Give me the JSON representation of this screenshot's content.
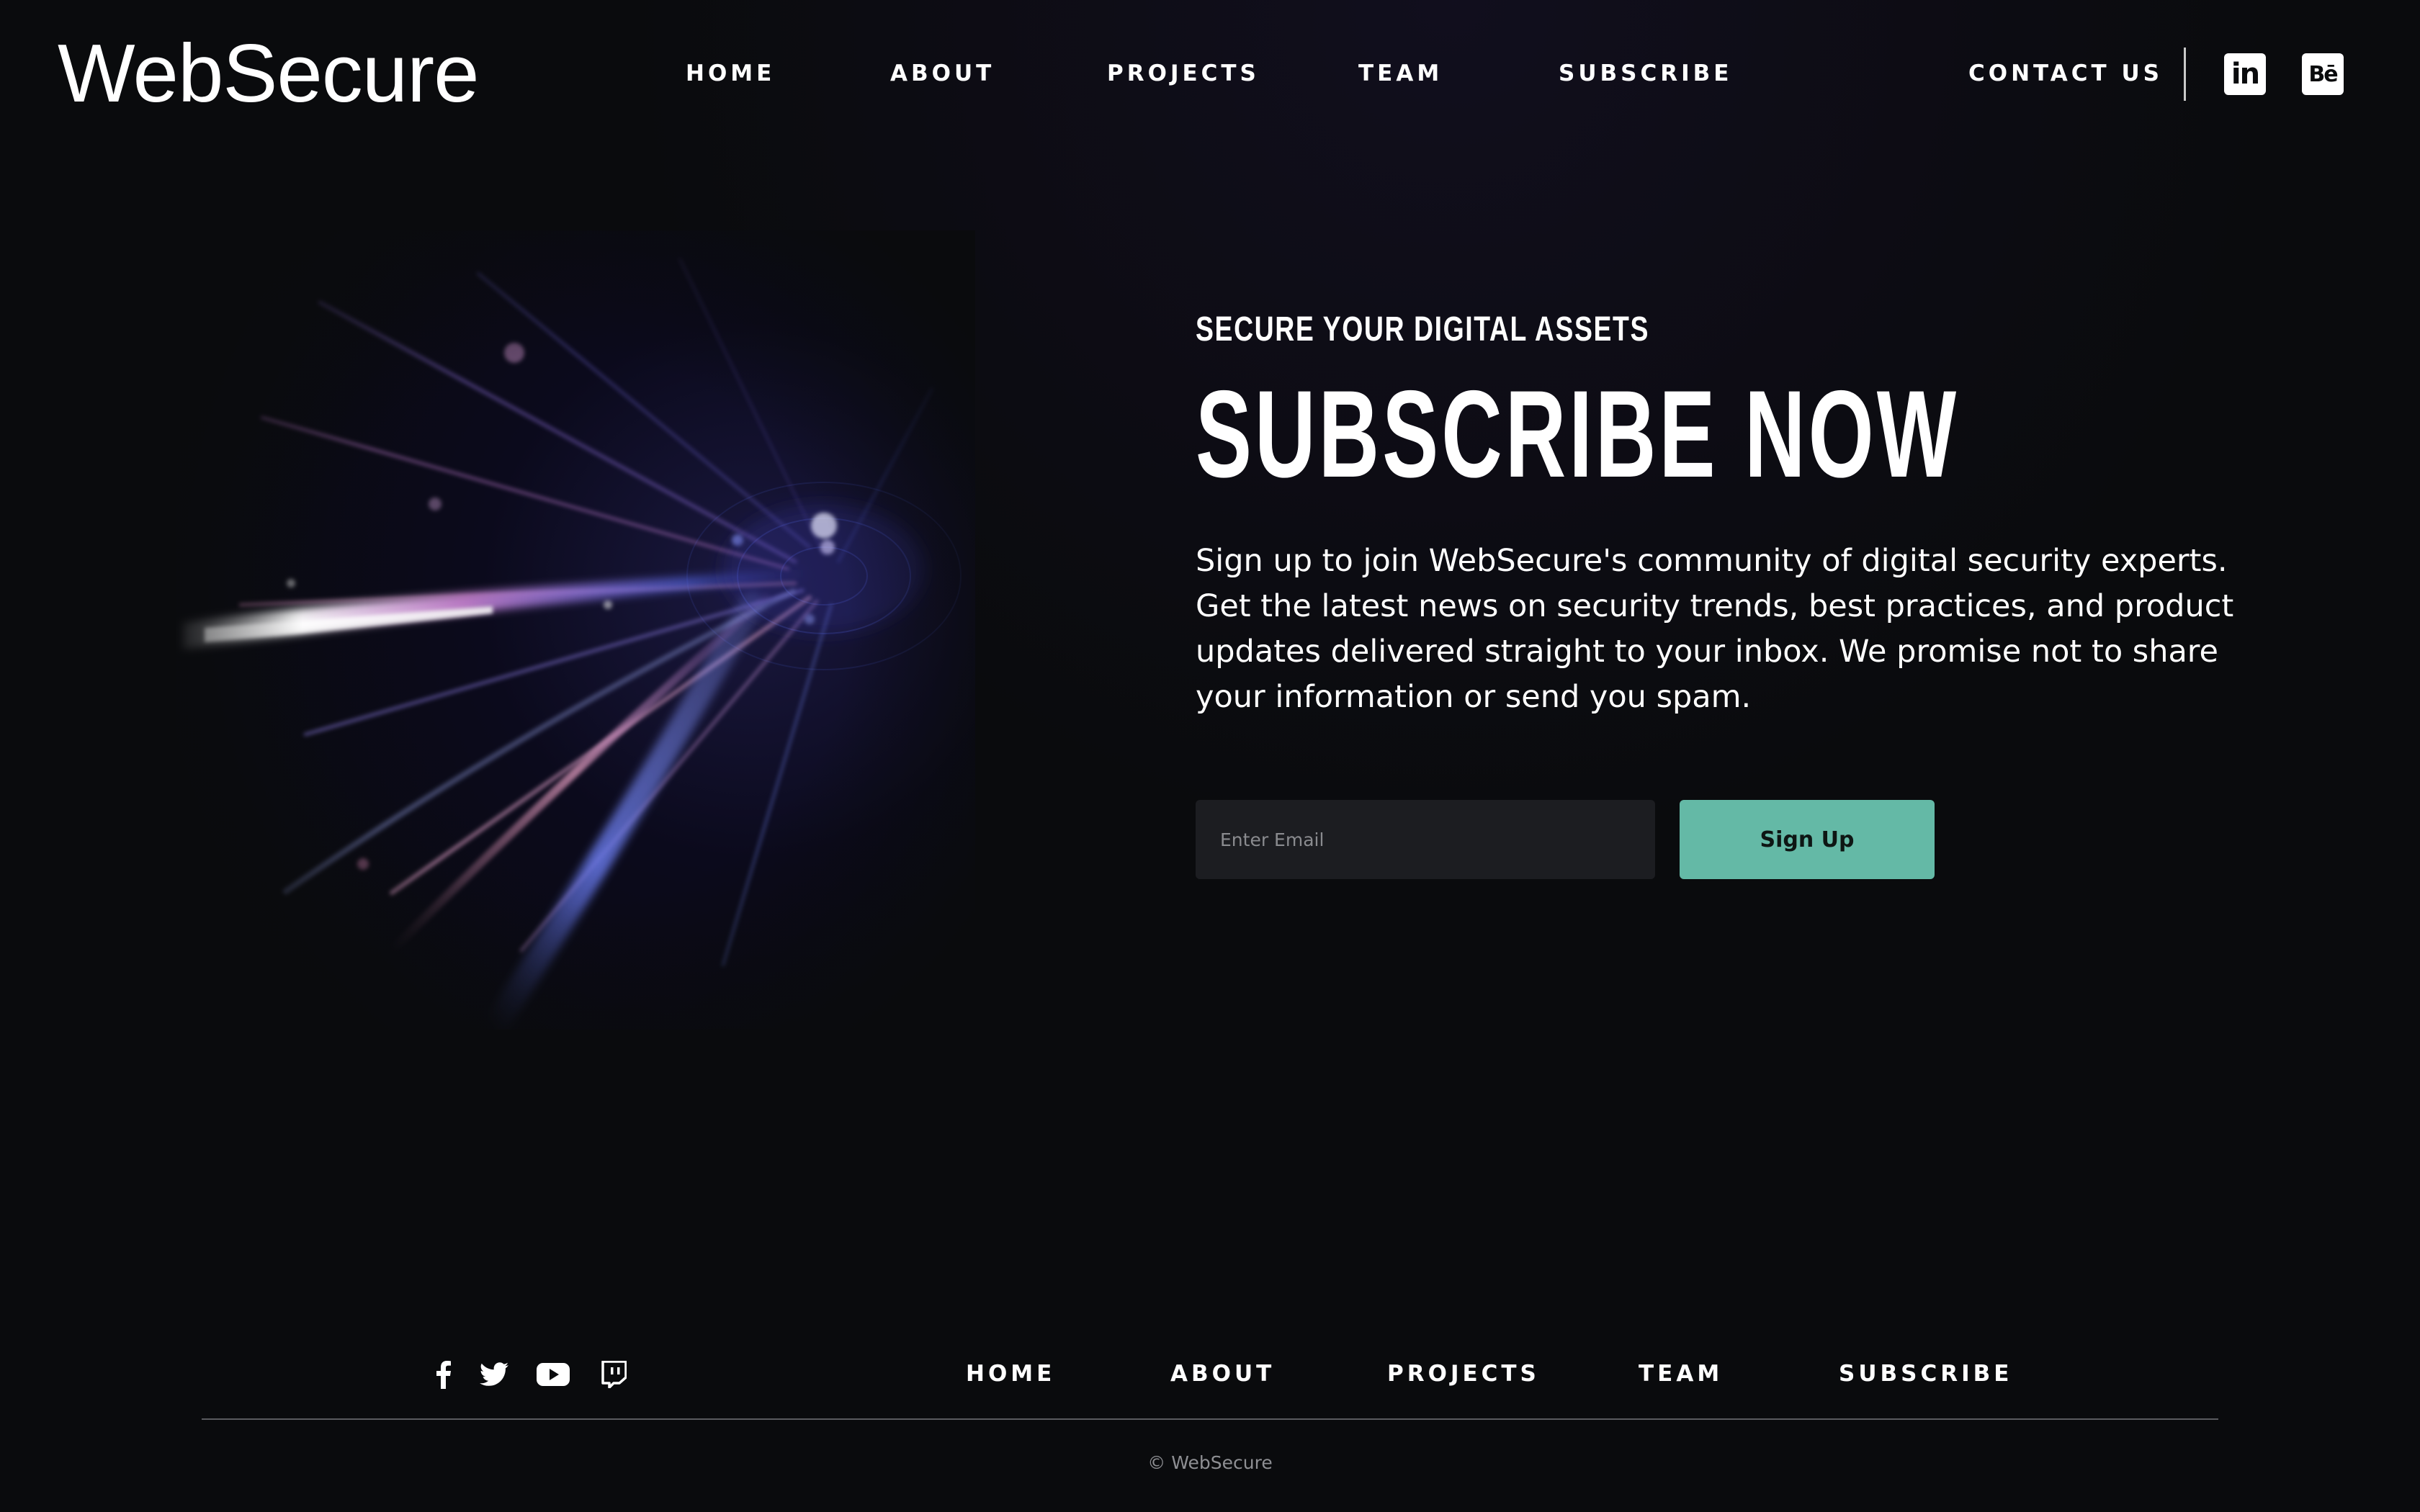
{
  "brand": {
    "logo": "WebSecure"
  },
  "header": {
    "nav": [
      "HOME",
      "ABOUT",
      "PROJECTS",
      "TEAM",
      "SUBSCRIBE"
    ],
    "contact_label": "CONTACT US",
    "social": [
      {
        "icon": "linkedin-icon",
        "glyph": "in"
      },
      {
        "icon": "behance-icon",
        "glyph": "Bē"
      }
    ]
  },
  "hero": {
    "image_icon": "light-speed-tunnel-image",
    "eyebrow": "SECURE YOUR DIGITAL ASSETS",
    "headline": "SUBSCRIBE NOW",
    "description": "Sign up to join WebSecure's community of digital security experts. Get the latest news on security trends, best practices, and product updates delivered straight to your inbox. We promise not to share your information or send you spam.",
    "email_placeholder": "Enter Email",
    "email_value": "",
    "signup_label": "Sign Up"
  },
  "footer": {
    "social": [
      "facebook-icon",
      "twitter-icon",
      "youtube-icon",
      "twitch-icon"
    ],
    "nav": [
      "HOME",
      "ABOUT",
      "PROJECTS",
      "TEAM",
      "SUBSCRIBE"
    ],
    "copyright": "© WebSecure"
  },
  "colors": {
    "background": "#0a0b0d",
    "accent": "#64b9a6",
    "input_bg": "#1c1d21",
    "text": "#ffffff",
    "muted": "#8e8f93"
  }
}
